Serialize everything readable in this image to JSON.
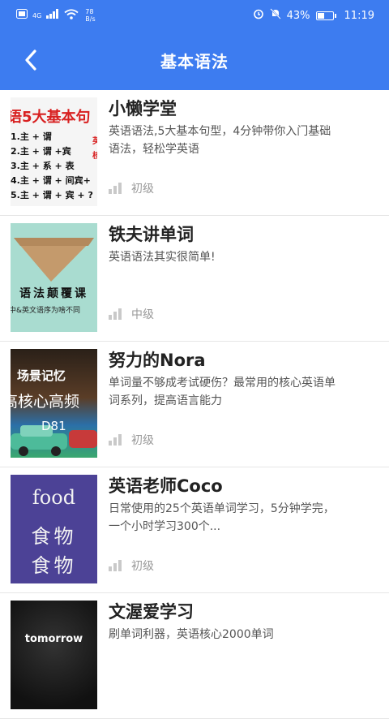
{
  "status_bar": {
    "signal": "4G",
    "net_speed_value": "78",
    "net_speed_unit": "B/s",
    "battery": "43%",
    "time": "11:19"
  },
  "header": {
    "title": "基本语法",
    "back_icon": "chevron-left-icon"
  },
  "colors": {
    "brand": "#3d7cf0"
  },
  "items": [
    {
      "name": "小懒学堂",
      "desc": "英语语法,5大基本句型，4分钟带你入门基础语法，轻松学英语",
      "level": "初级",
      "thumb": {
        "title": "语5大基本句",
        "lines": [
          "1.主 + 谓",
          "2.主 + 谓 +宾",
          "3.主 + 系 + 表",
          "4.主 + 谓 + 间宾+",
          "5.主 + 谓 + 宾 + ?"
        ],
        "red_lines": [
          "英",
          "核"
        ]
      }
    },
    {
      "name": "铁夫讲单词",
      "desc": "英语语法其实很简单!",
      "level": "中级",
      "thumb": {
        "text": "语法颠覆课",
        "sub": "中&英文语序为啥不同"
      }
    },
    {
      "name": "努力的Nora",
      "desc": "单词量不够成考试硬伤？最常用的核心英语单词系列，提高语言能力",
      "level": "初级",
      "thumb": {
        "a": "场景记忆",
        "b": "高核心高频",
        "c": "D81"
      }
    },
    {
      "name": "英语老师Coco",
      "desc": "日常使用的25个英语单词学习，5分钟学完，一个小时学习300个...",
      "level": "初级",
      "thumb": {
        "a": "food",
        "b": "食物",
        "c": "食物"
      }
    },
    {
      "name": "文渥爱学习",
      "desc": "刷单词利器，英语核心2000单词",
      "level": "",
      "thumb": {
        "a": "tomorrow"
      }
    }
  ]
}
